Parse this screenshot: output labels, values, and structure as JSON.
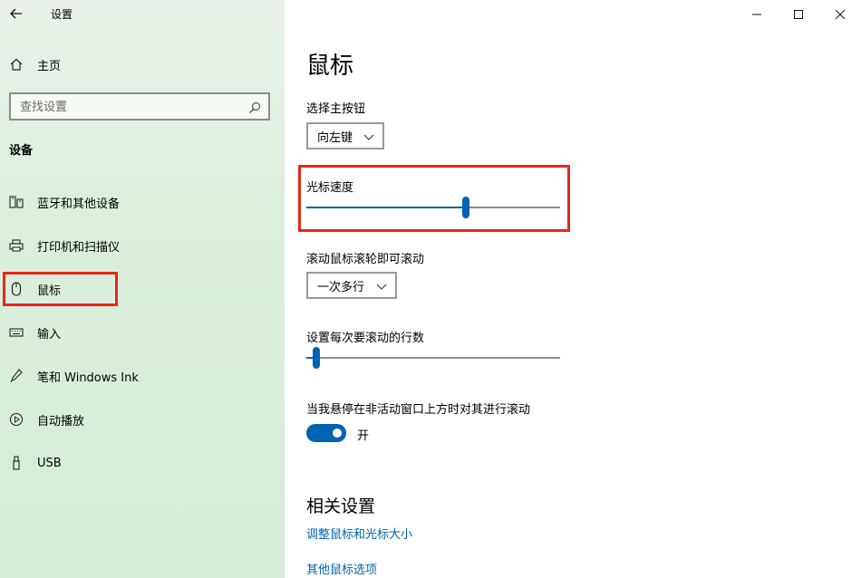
{
  "window": {
    "back_icon": "back-arrow-icon",
    "title": "设置",
    "controls": [
      "minimize-icon",
      "maximize-icon",
      "close-icon"
    ]
  },
  "sidebar": {
    "home": {
      "label": "主页",
      "icon": "home-icon"
    },
    "search": {
      "placeholder": "查找设置",
      "icon": "search-icon"
    },
    "section": "设备",
    "items": [
      {
        "label": "蓝牙和其他设备",
        "icon": "bluetooth-devices-icon"
      },
      {
        "label": "打印机和扫描仪",
        "icon": "printer-icon"
      },
      {
        "label": "鼠标",
        "icon": "mouse-icon",
        "selected": true
      },
      {
        "label": "输入",
        "icon": "keyboard-icon"
      },
      {
        "label": "笔和 Windows Ink",
        "icon": "pen-icon"
      },
      {
        "label": "自动播放",
        "icon": "autoplay-icon"
      },
      {
        "label": "USB",
        "icon": "usb-icon"
      }
    ]
  },
  "main": {
    "title": "鼠标",
    "primary_button": {
      "label": "选择主按钮",
      "value": "向左键"
    },
    "cursor_speed": {
      "label": "光标速度",
      "value_fraction": 0.63
    },
    "scroll_mode": {
      "label": "滚动鼠标滚轮即可滚动",
      "value": "一次多行"
    },
    "scroll_lines": {
      "label": "设置每次要滚动的行数",
      "value_fraction": 0.04
    },
    "inactive_scroll": {
      "label": "当我悬停在非活动窗口上方时对其进行滚动",
      "state": "开",
      "on": true
    },
    "related": {
      "title": "相关设置",
      "links": [
        "调整鼠标和光标大小",
        "其他鼠标选项"
      ]
    }
  },
  "colors": {
    "accent": "#0063b1",
    "highlight": "#e8261b"
  }
}
